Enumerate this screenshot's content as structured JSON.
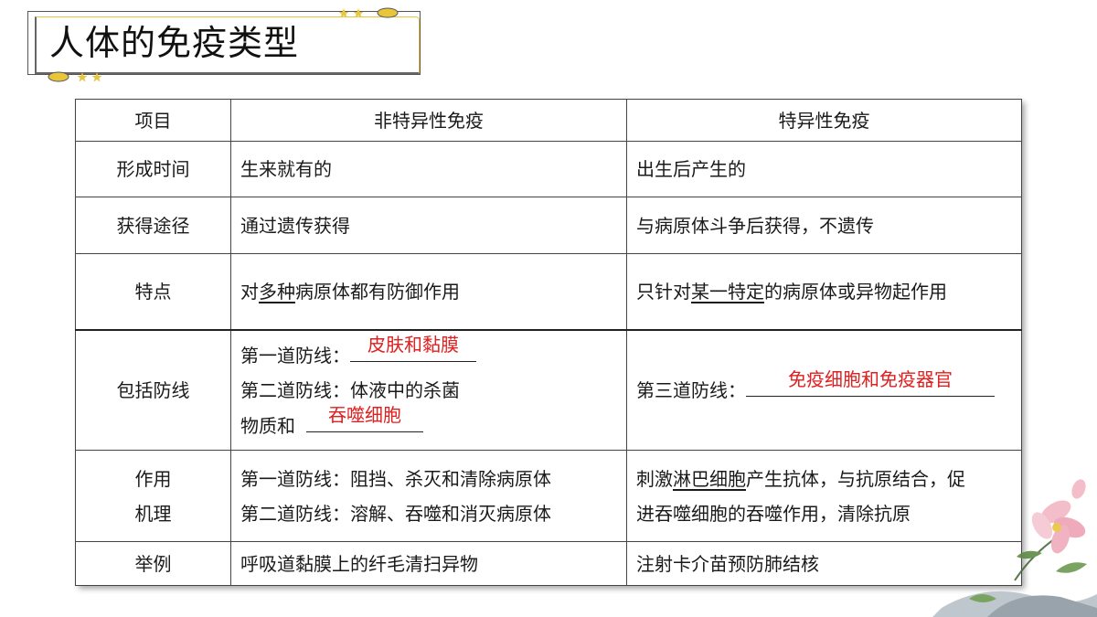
{
  "title": "人体的免疫类型",
  "table": {
    "headers": [
      "项目",
      "非特异性免疫",
      "特异性免疫"
    ],
    "rows": {
      "formation_time": {
        "label": "形成时间",
        "nonspecific": "生来就有的",
        "specific": "出生后产生的"
      },
      "acquisition": {
        "label": "获得途径",
        "nonspecific": "通过遗传获得",
        "specific": "与病原体斗争后获得，不遗传"
      },
      "features": {
        "label": "特点",
        "nonspecific": {
          "pre": "对",
          "ul": "多种",
          "post": "病原体都有防御作用"
        },
        "specific": {
          "pre": "只针对",
          "ul": "某一特定",
          "post": "的病原体或异物起作用"
        }
      },
      "defense_lines": {
        "label": "包括防线",
        "nonspecific": {
          "line1_prefix": "第一道防线：",
          "line1_answer": "皮肤和黏膜",
          "line2_text": "第二道防线：体液中的杀菌",
          "line3_prefix": "物质和",
          "line3_answer": "吞噬细胞"
        },
        "specific": {
          "prefix": "第三道防线：",
          "answer": "免疫细胞和免疫器官"
        }
      },
      "mechanism": {
        "label_line1": "作用",
        "label_line2": "机理",
        "nonspecific_line1": "第一道防线：阻挡、杀灭和清除病原体",
        "nonspecific_line2": "第二道防线：溶解、吞噬和消灭病原体",
        "specific": {
          "pre": "刺激",
          "ul": "淋巴细胞",
          "post": "产生抗体，与抗原结合，促",
          "line2": "进吞噬细胞的吞噬作用，清除抗原"
        }
      },
      "example": {
        "label": "举例",
        "nonspecific": "呼吸道黏膜上的纤毛清扫异物",
        "specific": "注射卡介苗预防肺结核"
      }
    }
  },
  "colors": {
    "answer": "#e02020",
    "gold_accent": "#e8c53a",
    "border": "#444444"
  }
}
